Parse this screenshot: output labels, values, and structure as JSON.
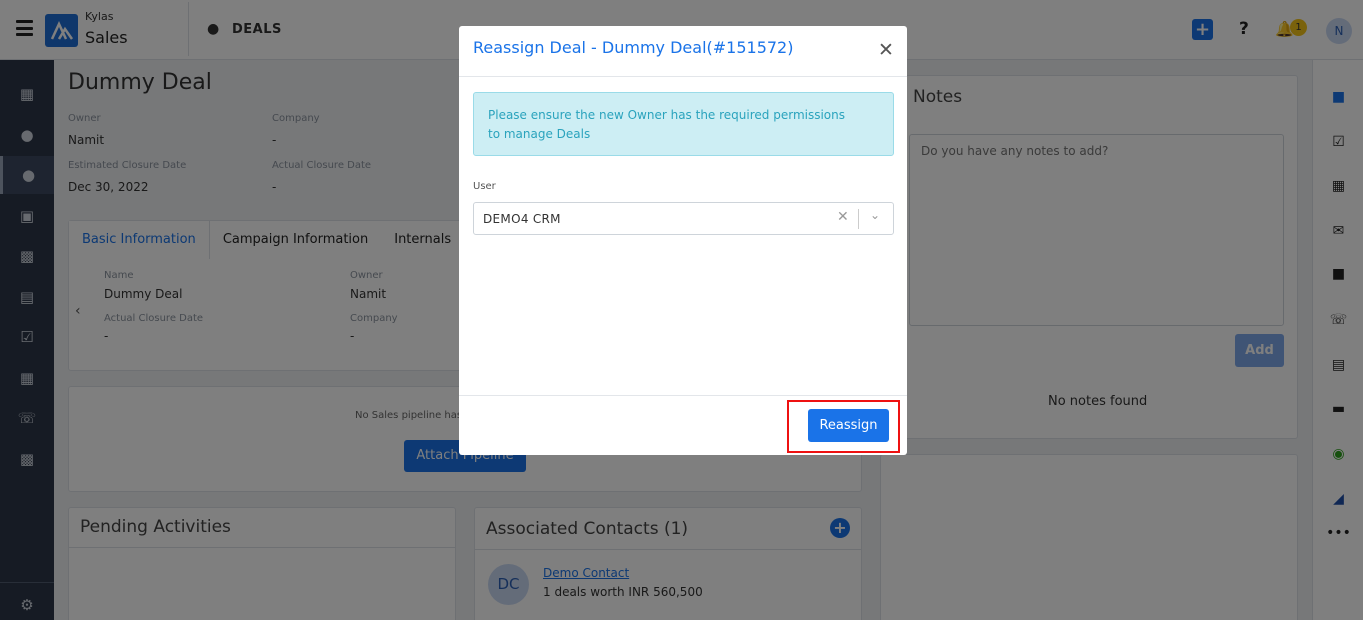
{
  "header": {
    "brand_top": "Kylas",
    "brand_bottom": "Sales",
    "section": "DEALS",
    "notification_count": "1",
    "avatar_initial": "N"
  },
  "deal": {
    "title": "Dummy Deal",
    "owner_label": "Owner",
    "owner_value": "Namit",
    "company_label": "Company",
    "company_value": "-",
    "est_close_label": "Estimated Closure Date",
    "est_close_value": "Dec 30, 2022",
    "actual_close_label": "Actual Closure Date",
    "actual_close_value": "-"
  },
  "tabs": [
    "Basic Information",
    "Campaign Information",
    "Internals"
  ],
  "basic_info": {
    "name_label": "Name",
    "name_value": "Dummy Deal",
    "owner_label": "Owner",
    "owner_value": "Namit",
    "actual_close_label": "Actual Closure Date",
    "actual_close_value": "-",
    "company_label": "Company",
    "company_value": "-"
  },
  "pipeline": {
    "message": "No Sales pipeline has",
    "button": "Attach Pipeline"
  },
  "pending": {
    "title": "Pending Activities"
  },
  "contacts": {
    "title": "Associated Contacts (1)",
    "avatar": "DC",
    "name": "Demo Contact",
    "sub": "1 deals worth INR 560,500"
  },
  "notes": {
    "title": "Notes",
    "placeholder": "Do you have any notes to add?",
    "add_button": "Add",
    "empty": "No notes found"
  },
  "modal": {
    "title": "Reassign Deal - Dummy Deal(#151572)",
    "alert_line1": "Please ensure the new Owner has the required permissions",
    "alert_line2": "to manage Deals",
    "user_label": "User",
    "user_value": "DEMO4 CRM",
    "submit": "Reassign"
  },
  "colors": {
    "primary": "#1a73e8",
    "sidebar": "#2d3748",
    "alert_bg": "#cdeef4",
    "highlight": "#e11111"
  }
}
